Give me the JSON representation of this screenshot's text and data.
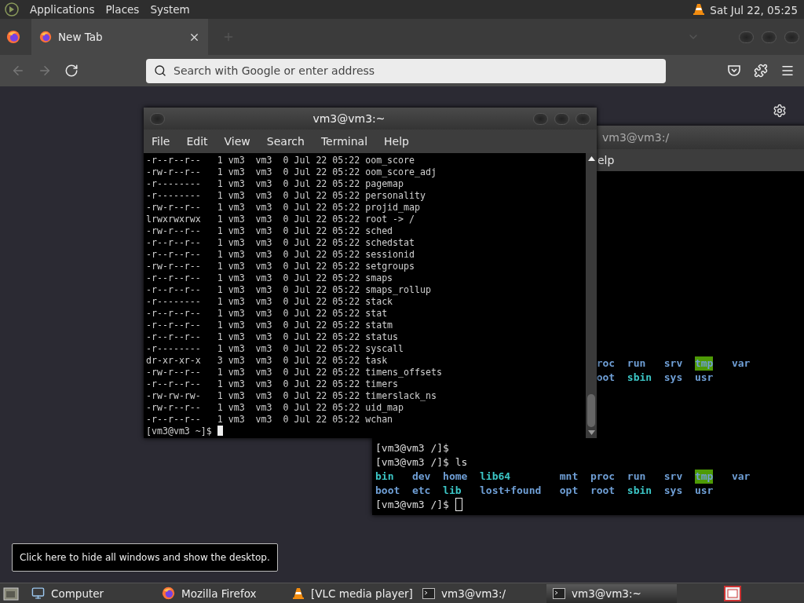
{
  "top_panel": {
    "menus": [
      "Applications",
      "Places",
      "System"
    ],
    "clock": "Sat Jul 22, 05:25"
  },
  "browser": {
    "tabs": [
      {
        "label": "New Tab",
        "selected": true
      }
    ],
    "nav_buttons": [
      {
        "kind": "back",
        "disabled": true
      },
      {
        "kind": "forward",
        "disabled": true
      },
      {
        "kind": "reload",
        "disabled": false
      }
    ],
    "address_bar": {
      "placeholder": "Search with Google or enter address"
    }
  },
  "back_terminal": {
    "title": "vm3@vm3:/",
    "menus": [
      "elp"
    ],
    "output": [
      {
        "kind": "ls_cut",
        "entries": [
          {
            "name": "roc",
            "kind": "dir"
          },
          {
            "name": "run",
            "kind": "dir"
          },
          {
            "name": "srv",
            "kind": "dir"
          },
          {
            "name": "tmp",
            "kind": "sticky"
          },
          {
            "name": "var",
            "kind": "dir"
          }
        ]
      },
      {
        "kind": "ls_cut",
        "entries": [
          {
            "name": "oot",
            "kind": "dir"
          },
          {
            "name": "sbin",
            "kind": "link"
          },
          {
            "name": "sys",
            "kind": "dir"
          },
          {
            "name": "usr",
            "kind": "dir"
          }
        ]
      },
      {
        "kind": "text",
        "text": "[vm3@vm3 /]$"
      },
      {
        "kind": "text",
        "text": "[vm3@vm3 /]$ ls"
      },
      {
        "kind": "ls",
        "entries": [
          {
            "name": "bin",
            "kind": "link"
          },
          {
            "name": "dev",
            "kind": "dir"
          },
          {
            "name": "home",
            "kind": "dir"
          },
          {
            "name": "lib64",
            "kind": "link"
          },
          {
            "name": "mnt",
            "kind": "dir"
          },
          {
            "name": "proc",
            "kind": "dir"
          },
          {
            "name": "run",
            "kind": "dir"
          },
          {
            "name": "srv",
            "kind": "dir"
          },
          {
            "name": "tmp",
            "kind": "sticky"
          },
          {
            "name": "var",
            "kind": "dir"
          }
        ]
      },
      {
        "kind": "ls",
        "entries": [
          {
            "name": "boot",
            "kind": "dir"
          },
          {
            "name": "etc",
            "kind": "dir"
          },
          {
            "name": "lib",
            "kind": "link"
          },
          {
            "name": "lost+found",
            "kind": "dir"
          },
          {
            "name": "opt",
            "kind": "dir"
          },
          {
            "name": "root",
            "kind": "dir"
          },
          {
            "name": "sbin",
            "kind": "link"
          },
          {
            "name": "sys",
            "kind": "dir"
          },
          {
            "name": "usr",
            "kind": "dir"
          }
        ]
      },
      {
        "kind": "prompt",
        "text": "[vm3@vm3 /]$ "
      }
    ]
  },
  "front_terminal": {
    "title": "vm3@vm3:~",
    "menus": [
      "File",
      "Edit",
      "View",
      "Search",
      "Terminal",
      "Help"
    ],
    "lines": [
      "-r--r--r--   1 vm3  vm3  0 Jul 22 05:22 oom_score",
      "-rw-r--r--   1 vm3  vm3  0 Jul 22 05:22 oom_score_adj",
      "-r--------   1 vm3  vm3  0 Jul 22 05:22 pagemap",
      "-r--------   1 vm3  vm3  0 Jul 22 05:22 personality",
      "-rw-r--r--   1 vm3  vm3  0 Jul 22 05:22 projid_map",
      "lrwxrwxrwx   1 vm3  vm3  0 Jul 22 05:22 root -> /",
      "-rw-r--r--   1 vm3  vm3  0 Jul 22 05:22 sched",
      "-r--r--r--   1 vm3  vm3  0 Jul 22 05:22 schedstat",
      "-r--r--r--   1 vm3  vm3  0 Jul 22 05:22 sessionid",
      "-rw-r--r--   1 vm3  vm3  0 Jul 22 05:22 setgroups",
      "-r--r--r--   1 vm3  vm3  0 Jul 22 05:22 smaps",
      "-r--r--r--   1 vm3  vm3  0 Jul 22 05:22 smaps_rollup",
      "-r--------   1 vm3  vm3  0 Jul 22 05:22 stack",
      "-r--r--r--   1 vm3  vm3  0 Jul 22 05:22 stat",
      "-r--r--r--   1 vm3  vm3  0 Jul 22 05:22 statm",
      "-r--r--r--   1 vm3  vm3  0 Jul 22 05:22 status",
      "-r--------   1 vm3  vm3  0 Jul 22 05:22 syscall",
      "dr-xr-xr-x   3 vm3  vm3  0 Jul 22 05:22 task",
      "-rw-r--r--   1 vm3  vm3  0 Jul 22 05:22 timens_offsets",
      "-r--r--r--   1 vm3  vm3  0 Jul 22 05:22 timers",
      "-rw-rw-rw-   1 vm3  vm3  0 Jul 22 05:22 timerslack_ns",
      "-rw-r--r--   1 vm3  vm3  0 Jul 22 05:22 uid_map",
      "-r--r--r--   1 vm3  vm3  0 Jul 22 05:22 wchan"
    ],
    "prompt": "[vm3@vm3 ~]$ "
  },
  "tooltip": "Click here to hide all windows and show the desktop.",
  "taskbar": [
    {
      "label": "Computer",
      "kind": "computer",
      "selected": false
    },
    {
      "label": "Mozilla Firefox",
      "kind": "firefox",
      "selected": false
    },
    {
      "label": "[VLC media player]",
      "kind": "vlc",
      "selected": false
    },
    {
      "label": "vm3@vm3:/",
      "kind": "terminal",
      "selected": false
    },
    {
      "label": "vm3@vm3:~",
      "kind": "terminal",
      "selected": true
    }
  ]
}
